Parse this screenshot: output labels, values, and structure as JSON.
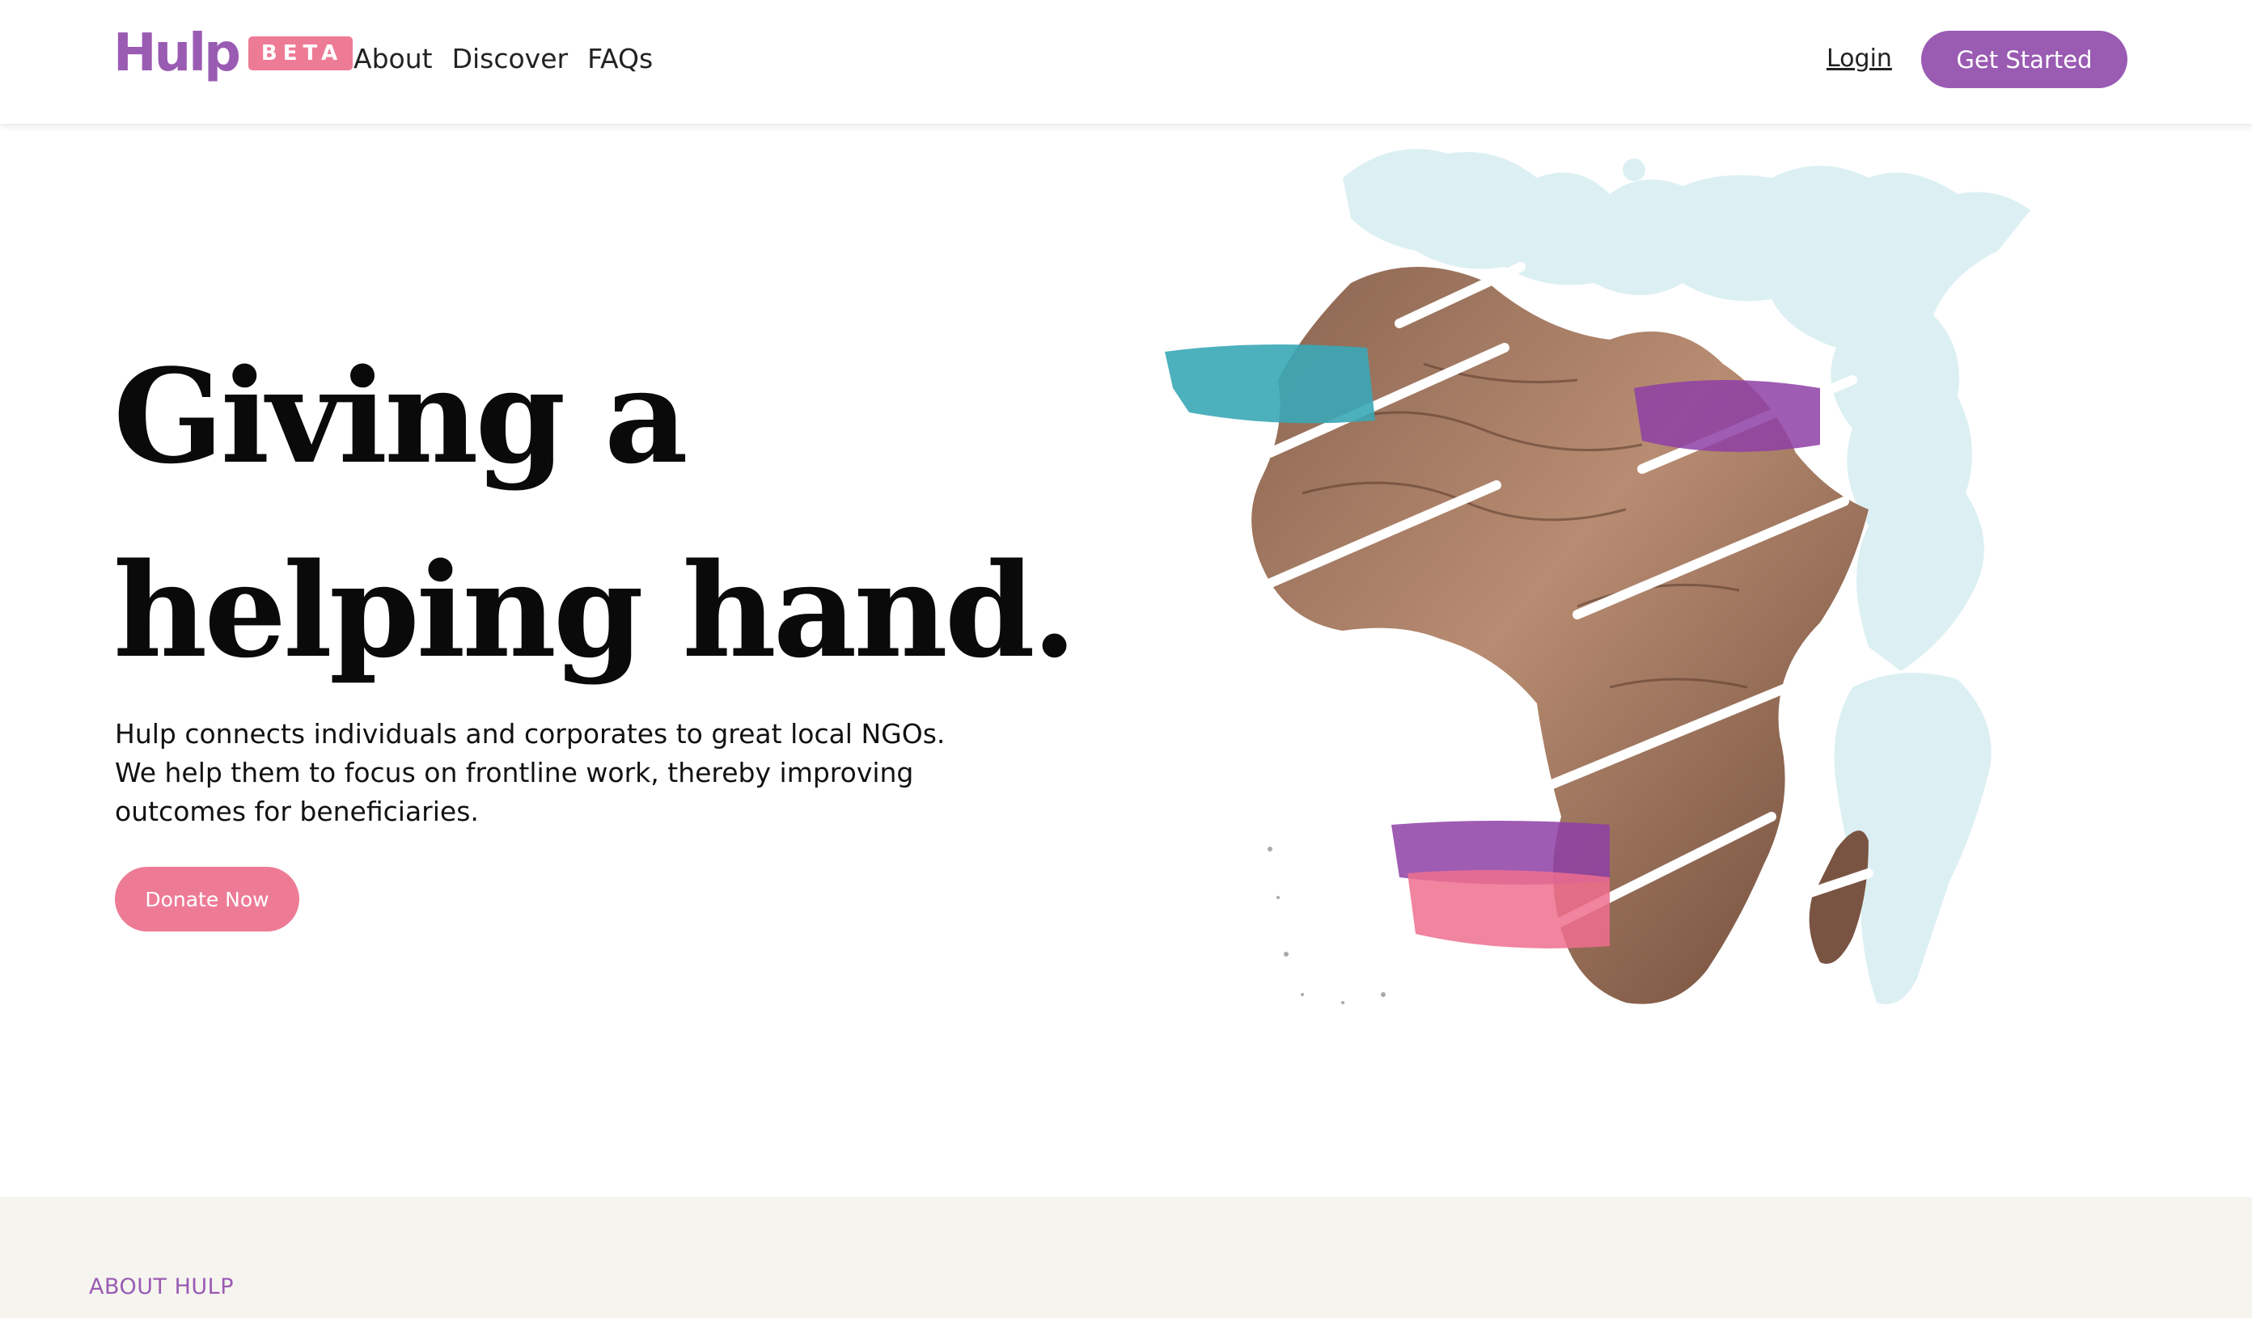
{
  "header": {
    "logo_text": "Hulp",
    "logo_badge": "BETA",
    "nav": [
      {
        "label": "About"
      },
      {
        "label": "Discover"
      },
      {
        "label": "FAQs"
      }
    ],
    "login_label": "Login",
    "cta_label": "Get Started"
  },
  "hero": {
    "title_line1": "Giving a",
    "title_line2": "helping hand.",
    "description": "Hulp connects individuals and corporates to great local NGOs. We help them to focus on frontline work, thereby improving outcomes for beneficiaries.",
    "donate_label": "Donate Now"
  },
  "about": {
    "section_label": "ABOUT HULP"
  },
  "colors": {
    "brand_purple": "#9a5bb3",
    "brand_pink": "#ee7b96",
    "map_blue": "#dff1f4",
    "teal_brush": "#3aa7b6"
  }
}
